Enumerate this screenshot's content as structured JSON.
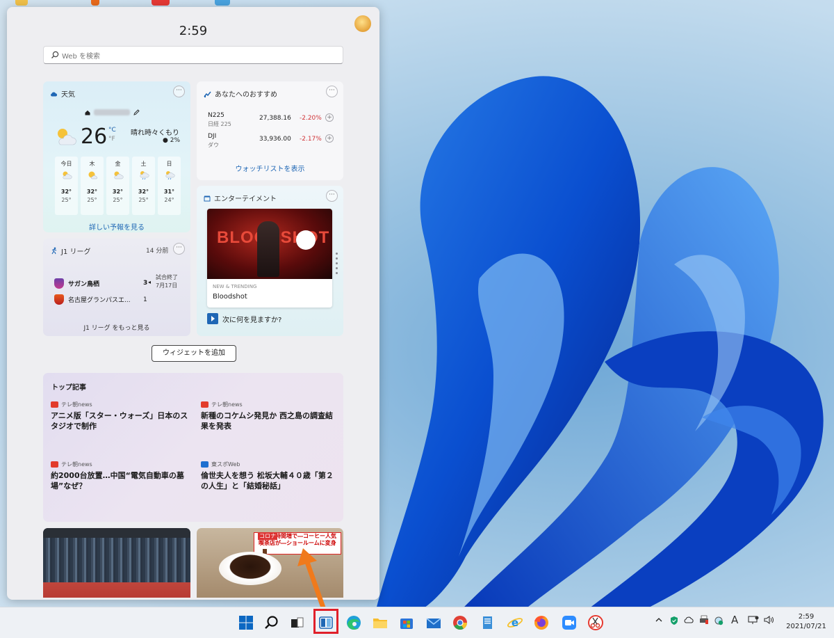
{
  "panel": {
    "clock": "2:59",
    "search_placeholder": "Web を検索"
  },
  "weather": {
    "title": "天気",
    "temp": "26",
    "unit_c": "°C",
    "unit_f": "°F",
    "condition": "晴れ時々くもり",
    "precip": "2%",
    "days": [
      {
        "name": "今日",
        "hi": "32°",
        "lo": "25°"
      },
      {
        "name": "木",
        "hi": "32°",
        "lo": "25°"
      },
      {
        "name": "金",
        "hi": "32°",
        "lo": "25°"
      },
      {
        "name": "土",
        "hi": "32°",
        "lo": "25°"
      },
      {
        "name": "日",
        "hi": "31°",
        "lo": "24°"
      }
    ],
    "forecast_link": "詳しい予報を見る"
  },
  "stocks": {
    "title": "あなたへのおすすめ",
    "rows": [
      {
        "symbol": "N225",
        "name": "日経 225",
        "price": "27,388.16",
        "change": "-2.20%"
      },
      {
        "symbol": "DJI",
        "name": "ダウ",
        "price": "33,936.00",
        "change": "-2.17%"
      }
    ],
    "watchlist_link": "ウォッチリストを表示"
  },
  "entertainment": {
    "title": "エンターテイメント",
    "poster_text": "BLOODSHOT",
    "trending": "NEW & TRENDING",
    "movie": "Bloodshot",
    "next": "次に何を見ますか?"
  },
  "j1": {
    "title": "J1 リーグ",
    "ago": "14 分前",
    "team1": "サガン鳥栖",
    "score1": "3",
    "team2": "名古屋グランパスエ...",
    "score2": "1",
    "status": "試合終了",
    "date": "7月17日",
    "more_link": "J1 リーグ をもっと見る"
  },
  "add_widget": "ウィジェットを追加",
  "news": {
    "title": "トップ記事",
    "articles": [
      {
        "source": "テレ朝news",
        "headline": "アニメ版「スター・ウォーズ」日本のスタジオで制作"
      },
      {
        "source": "テレ朝news",
        "headline": "新種のコケムシ発見か 西之島の調査結果を発表"
      },
      {
        "source": "テレ朝news",
        "headline": "約2000台放置…中国“電気自動車の墓場”なぜ？"
      },
      {
        "source": "東スポWeb",
        "headline": "倫世夫人を想う 松坂大輔４０歳「第２の人生」と「結婚秘話」"
      }
    ]
  },
  "image_card2": {
    "badge": "コロナ",
    "caption_line1": "おウチ時間増で―コーヒー人気",
    "caption_line2": "喫茶店が―ショールームに変身"
  },
  "taskbar": {
    "time": "2:59",
    "date": "2021/07/21",
    "ime": "A",
    "colors": {
      "highlight": "#e0202a",
      "accent": "#0b67c2"
    }
  }
}
